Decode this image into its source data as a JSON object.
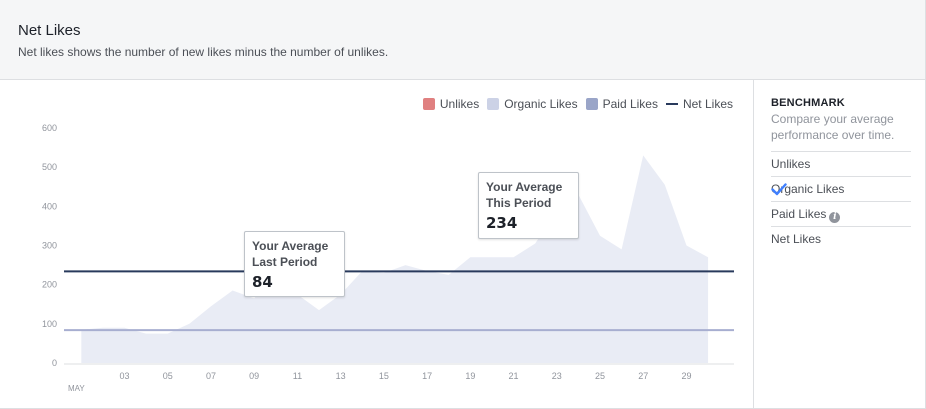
{
  "header": {
    "title": "Net Likes",
    "subtitle": "Net likes shows the number of new likes minus the number of unlikes."
  },
  "legend": [
    {
      "label": "Unlikes",
      "color": "#e08080",
      "kind": "box"
    },
    {
      "label": "Organic Likes",
      "color": "#ccd2e6",
      "kind": "box"
    },
    {
      "label": "Paid Likes",
      "color": "#9aa5c8",
      "kind": "box"
    },
    {
      "label": "Net Likes",
      "color": "#293a5c",
      "kind": "line"
    }
  ],
  "callouts": {
    "last": {
      "title": "Your Average Last Period",
      "value": "84"
    },
    "this": {
      "title": "Your Average This Period",
      "value": "234"
    }
  },
  "benchmark": {
    "title": "BENCHMARK",
    "description": "Compare your average performance over time.",
    "items": [
      {
        "label": "Unlikes",
        "checked": false,
        "info": false
      },
      {
        "label": "Organic Likes",
        "checked": true,
        "info": false
      },
      {
        "label": "Paid Likes",
        "checked": false,
        "info": true
      },
      {
        "label": "Net Likes",
        "checked": false,
        "info": false
      }
    ]
  },
  "colors": {
    "area": "#e9ecf5",
    "net_line": "#293a5c",
    "benchmark_line": "#a7aed0",
    "check": "#4080ff"
  },
  "chart_data": {
    "type": "area",
    "title": "Net Likes",
    "x_day": [
      1,
      2,
      3,
      4,
      5,
      6,
      7,
      8,
      9,
      10,
      11,
      12,
      13,
      14,
      15,
      16,
      17,
      18,
      19,
      20,
      21,
      22,
      23,
      24,
      25,
      26,
      27,
      28,
      29,
      30
    ],
    "y_ticks": [
      0,
      100,
      200,
      300,
      400,
      500,
      600
    ],
    "x_tick_labels": [
      "03",
      "05",
      "07",
      "09",
      "11",
      "13",
      "15",
      "17",
      "19",
      "21",
      "23",
      "25",
      "27",
      "29"
    ],
    "x_tick_days": [
      3,
      5,
      7,
      9,
      11,
      13,
      15,
      17,
      19,
      21,
      23,
      25,
      27,
      29
    ],
    "month_label": "MAY",
    "ylim": [
      0,
      600
    ],
    "xlim": [
      0.2,
      31.2
    ],
    "series": [
      {
        "name": "Organic Likes",
        "values": [
          85,
          90,
          90,
          75,
          75,
          100,
          145,
          185,
          165,
          230,
          175,
          135,
          175,
          235,
          230,
          250,
          235,
          225,
          270,
          270,
          270,
          305,
          390,
          430,
          325,
          290,
          530,
          455,
          300,
          270
        ]
      }
    ],
    "reference_lines": [
      {
        "name": "Net Likes",
        "value": 234
      },
      {
        "name": "Organic Likes",
        "value": 84
      }
    ]
  }
}
